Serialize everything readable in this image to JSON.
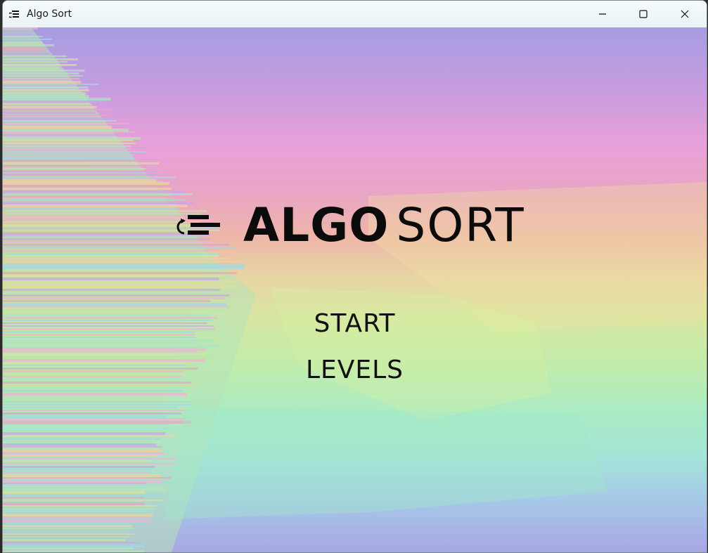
{
  "window": {
    "title": "Algo Sort",
    "app_icon": "algo-sort-icon",
    "controls": {
      "minimize_icon": "minimize-icon",
      "maximize_icon": "maximize-icon",
      "close_icon": "close-icon"
    }
  },
  "logo": {
    "icon": "sort-lines-icon",
    "word_bold": "ALGO",
    "word_light": "SORT"
  },
  "menu": {
    "items": [
      {
        "label": "START"
      },
      {
        "label": "LEVELS"
      }
    ]
  },
  "colors": {
    "text": "#0b0b0b",
    "titlebar": "#eef6f7",
    "bg_top": "#a79ce1",
    "bg_pink": "#e7a0d9",
    "bg_yellow": "#e7d6a3",
    "bg_green": "#c2ecab",
    "bg_cyan": "#a4e4d8",
    "bg_bottom": "#a9a6e6"
  }
}
